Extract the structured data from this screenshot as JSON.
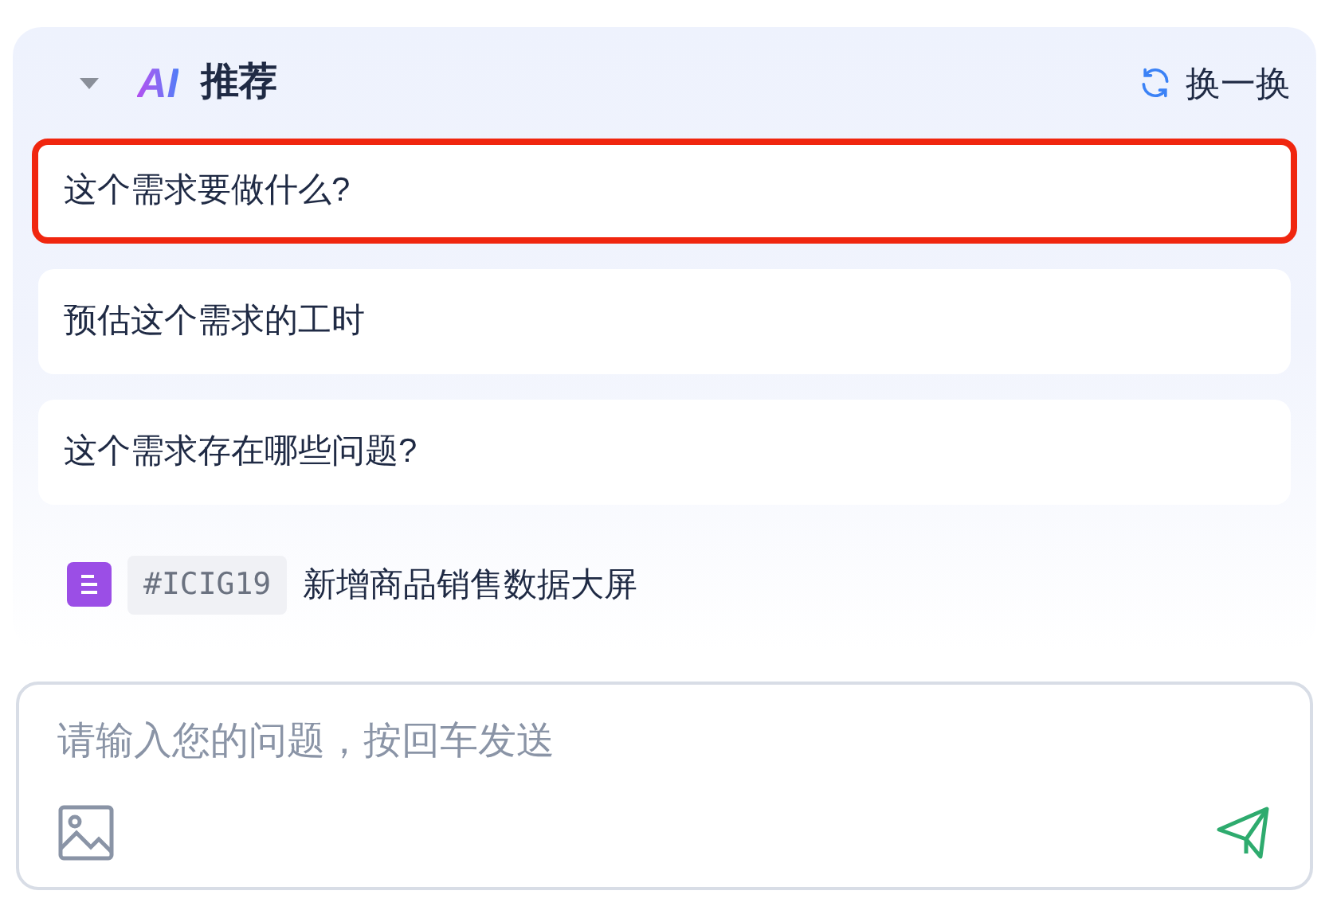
{
  "header": {
    "expanded": true,
    "logo": "AI",
    "title": "推荐",
    "refresh_label": "换一换"
  },
  "suggestions": [
    {
      "text": "这个需求要做什么?",
      "selected": true
    },
    {
      "text": "预估这个需求的工时",
      "selected": false
    },
    {
      "text": "这个需求存在哪些问题?",
      "selected": false
    }
  ],
  "reference": {
    "tag": "#ICIG19",
    "title": "新增商品销售数据大屏"
  },
  "input": {
    "placeholder": "请输入您的问题，按回车发送"
  }
}
